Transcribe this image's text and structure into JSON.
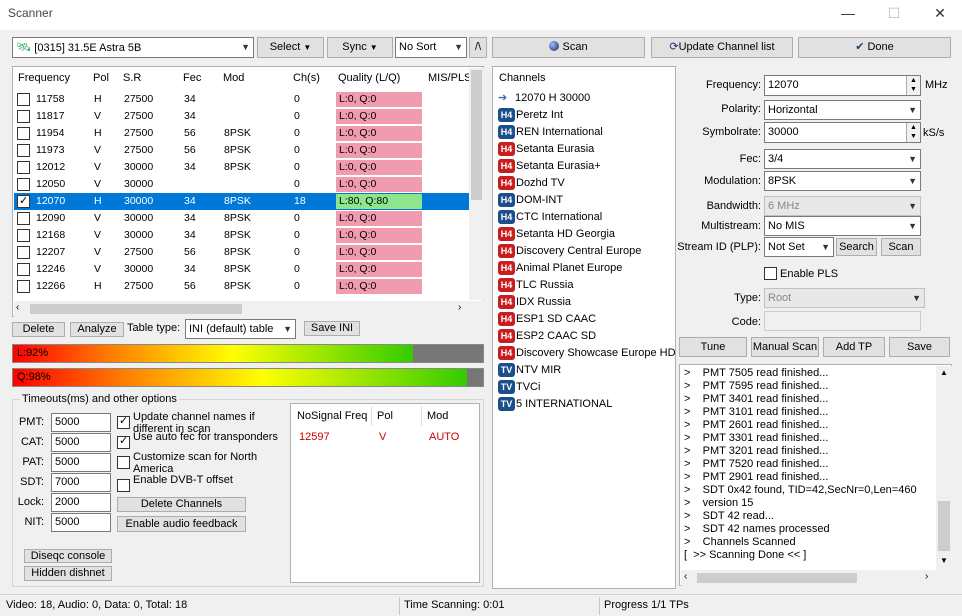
{
  "window": {
    "title": "Scanner"
  },
  "toolbar": {
    "satellite": "[0315]  31.5E  Astra 5B",
    "select_label": "Select",
    "sync_label": "Sync",
    "sort_label": "No Sort",
    "slash_label": "/\\",
    "scan_label": "Scan",
    "update_label": "Update Channel list",
    "done_label": "Done"
  },
  "tp_table": {
    "columns": [
      "Frequency",
      "Pol",
      "S.R",
      "Fec",
      "Mod",
      "Ch(s)",
      "Quality (L/Q)",
      "MIS/PLS"
    ],
    "rows": [
      {
        "freq": "11758",
        "pol": "H",
        "sr": "27500",
        "fec": "34",
        "mod": "",
        "ch": "0",
        "q": "L:0, Q:0",
        "checked": false,
        "selected": false
      },
      {
        "freq": "11817",
        "pol": "V",
        "sr": "27500",
        "fec": "34",
        "mod": "",
        "ch": "0",
        "q": "L:0, Q:0",
        "checked": false,
        "selected": false
      },
      {
        "freq": "11954",
        "pol": "H",
        "sr": "27500",
        "fec": "56",
        "mod": "8PSK",
        "ch": "0",
        "q": "L:0, Q:0",
        "checked": false,
        "selected": false
      },
      {
        "freq": "11973",
        "pol": "V",
        "sr": "27500",
        "fec": "56",
        "mod": "8PSK",
        "ch": "0",
        "q": "L:0, Q:0",
        "checked": false,
        "selected": false
      },
      {
        "freq": "12012",
        "pol": "V",
        "sr": "30000",
        "fec": "34",
        "mod": "8PSK",
        "ch": "0",
        "q": "L:0, Q:0",
        "checked": false,
        "selected": false
      },
      {
        "freq": "12050",
        "pol": "V",
        "sr": "30000",
        "fec": "",
        "mod": "",
        "ch": "0",
        "q": "L:0, Q:0",
        "checked": false,
        "selected": false
      },
      {
        "freq": "12070",
        "pol": "H",
        "sr": "30000",
        "fec": "34",
        "mod": "8PSK",
        "ch": "18",
        "q": "L:80, Q:80",
        "checked": true,
        "selected": true
      },
      {
        "freq": "12090",
        "pol": "V",
        "sr": "30000",
        "fec": "34",
        "mod": "8PSK",
        "ch": "0",
        "q": "L:0, Q:0",
        "checked": false,
        "selected": false
      },
      {
        "freq": "12168",
        "pol": "V",
        "sr": "30000",
        "fec": "34",
        "mod": "8PSK",
        "ch": "0",
        "q": "L:0, Q:0",
        "checked": false,
        "selected": false
      },
      {
        "freq": "12207",
        "pol": "V",
        "sr": "27500",
        "fec": "56",
        "mod": "8PSK",
        "ch": "0",
        "q": "L:0, Q:0",
        "checked": false,
        "selected": false
      },
      {
        "freq": "12246",
        "pol": "V",
        "sr": "30000",
        "fec": "34",
        "mod": "8PSK",
        "ch": "0",
        "q": "L:0, Q:0",
        "checked": false,
        "selected": false
      },
      {
        "freq": "12266",
        "pol": "H",
        "sr": "27500",
        "fec": "56",
        "mod": "8PSK",
        "ch": "0",
        "q": "L:0, Q:0",
        "checked": false,
        "selected": false
      }
    ]
  },
  "tp_actions": {
    "delete_label": "Delete",
    "analyze_label": "Analyze",
    "table_type_label": "Table type:",
    "table_type_value": "INI (default) table",
    "save_ini_label": "Save INI"
  },
  "meters": {
    "level_label": "L:92%",
    "level_value": 0.92,
    "quality_label": "Q:98%",
    "quality_value": 0.98
  },
  "timeouts": {
    "title": "Timeouts(ms) and other options",
    "fields": [
      {
        "label": "PMT:",
        "value": "5000"
      },
      {
        "label": "CAT:",
        "value": "5000"
      },
      {
        "label": "PAT:",
        "value": "5000"
      },
      {
        "label": "SDT:",
        "value": "7000"
      },
      {
        "label": "Lock:",
        "value": "2000"
      },
      {
        "label": "NIT:",
        "value": "5000"
      }
    ],
    "options": [
      {
        "label": "Update channel names if different in scan",
        "checked": true
      },
      {
        "label": "Use auto fec for transponders",
        "checked": true
      },
      {
        "label": "Customize scan for North America",
        "checked": false
      },
      {
        "label": "Enable DVB-T offset",
        "checked": false
      }
    ],
    "delete_channels_label": "Delete Channels",
    "audio_feedback_label": "Enable audio feedback",
    "diseqc_label": "Diseqc console",
    "dishnet_label": "Hidden dishnet"
  },
  "nosignal": {
    "columns": [
      "NoSignal Freq",
      "Pol",
      "Mod"
    ],
    "rows": [
      {
        "freq": "12597",
        "pol": "V",
        "mod": "AUTO"
      }
    ]
  },
  "channels": {
    "header": "Channels",
    "items": [
      {
        "icon": "tp",
        "name": "12070 H 30000"
      },
      {
        "icon": "h4b",
        "name": "Peretz Int"
      },
      {
        "icon": "h4b",
        "name": "REN International"
      },
      {
        "icon": "h4",
        "name": "Setanta Eurasia"
      },
      {
        "icon": "h4",
        "name": "Setanta Eurasia+"
      },
      {
        "icon": "h4",
        "name": "Dozhd TV"
      },
      {
        "icon": "h4b",
        "name": "DOM-INT"
      },
      {
        "icon": "h4b",
        "name": "CTC International"
      },
      {
        "icon": "h4",
        "name": "Setanta HD Georgia"
      },
      {
        "icon": "h4",
        "name": "Discovery Central Europe"
      },
      {
        "icon": "h4",
        "name": "Animal Planet Europe"
      },
      {
        "icon": "h4",
        "name": "TLC Russia"
      },
      {
        "icon": "h4",
        "name": "IDX Russia"
      },
      {
        "icon": "h4",
        "name": "ESP1 SD CAAC"
      },
      {
        "icon": "h4",
        "name": "ESP2 CAAC SD"
      },
      {
        "icon": "h4",
        "name": "Discovery Showcase Europe HD"
      },
      {
        "icon": "tv",
        "name": "NTV MIR"
      },
      {
        "icon": "tv",
        "name": "TVCi"
      },
      {
        "icon": "tv",
        "name": "5 INTERNATIONAL"
      }
    ]
  },
  "tuner": {
    "frequency_label": "Frequency:",
    "frequency_value": "12070",
    "frequency_unit": "MHz",
    "polarity_label": "Polarity:",
    "polarity_value": "Horizontal",
    "symbolrate_label": "Symbolrate:",
    "symbolrate_value": "30000",
    "symbolrate_unit": "kS/s",
    "fec_label": "Fec:",
    "fec_value": "3/4",
    "modulation_label": "Modulation:",
    "modulation_value": "8PSK",
    "bandwidth_label": "Bandwidth:",
    "bandwidth_value": "6 MHz",
    "multistream_label": "Multistream:",
    "multistream_value": "No MIS",
    "streamid_label": "Stream ID (PLP):",
    "streamid_value": "Not Set",
    "search_label": "Search",
    "scan_label": "Scan",
    "enable_pls_label": "Enable PLS",
    "type_label": "Type:",
    "type_value": "Root",
    "code_label": "Code:",
    "tune_label": "Tune",
    "manual_scan_label": "Manual Scan",
    "add_tp_label": "Add TP",
    "save_label": "Save"
  },
  "log": {
    "lines": [
      ">    PMT 7505 read finished...",
      ">    PMT 7595 read finished...",
      ">    PMT 3401 read finished...",
      ">    PMT 3101 read finished...",
      ">    PMT 2601 read finished...",
      ">    PMT 3301 read finished...",
      ">    PMT 3201 read finished...",
      ">    PMT 7520 read finished...",
      ">    PMT 2901 read finished...",
      ">    SDT 0x42 found, TID=42,SecNr=0,Len=460",
      ">    version 15",
      ">    SDT 42 read...",
      ">    SDT 42 names processed",
      ">    Channels Scanned",
      "[  >> Scanning Done << ]"
    ]
  },
  "statusbar": {
    "counts": "Video: 18, Audio: 0, Data: 0, Total: 18",
    "time": "Time Scanning: 0:01",
    "progress": "Progress 1/1 TPs"
  }
}
